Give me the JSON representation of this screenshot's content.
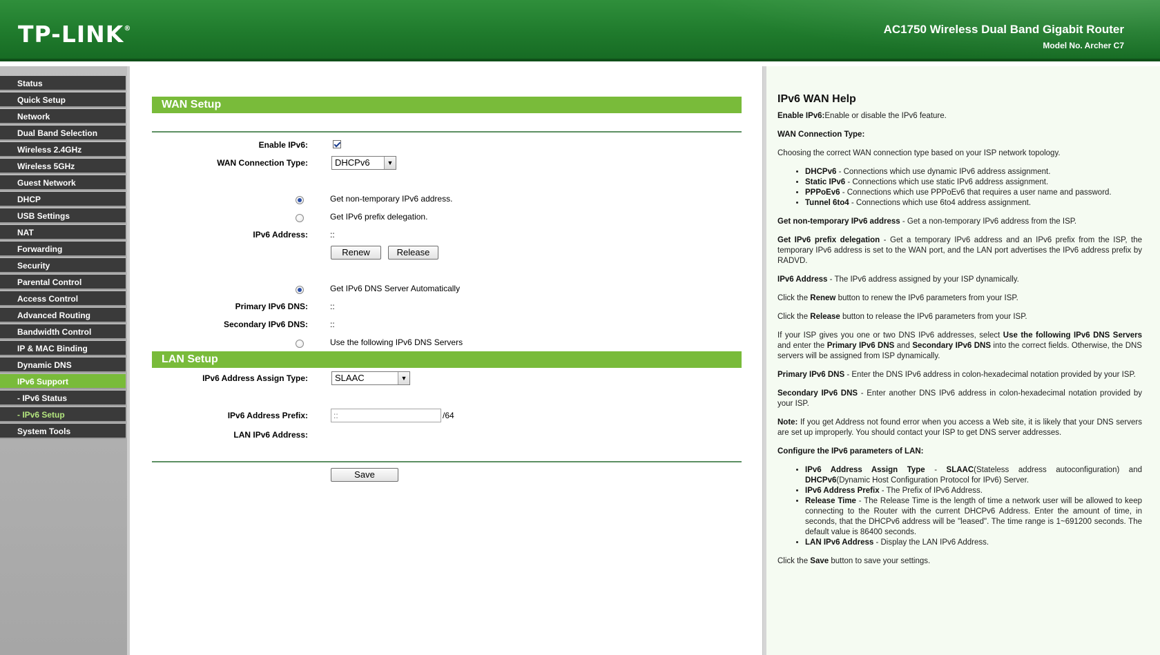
{
  "header": {
    "logo": "TP-LINK",
    "logo_mark": "®",
    "product": "AC1750 Wireless Dual Band Gigabit Router",
    "model": "Model No. Archer C7"
  },
  "colors": {
    "header_green": "#1f7a2c",
    "section_green": "#79bb3a",
    "menu_dark": "#3a3a3a",
    "menu_active": "#79bb3a",
    "submenu_current_text": "#b4e67f",
    "help_bg": "#f5fbf2"
  },
  "sidebar": {
    "items": [
      {
        "label": "Status"
      },
      {
        "label": "Quick Setup"
      },
      {
        "label": "Network"
      },
      {
        "label": "Dual Band Selection"
      },
      {
        "label": "Wireless 2.4GHz"
      },
      {
        "label": "Wireless 5GHz"
      },
      {
        "label": "Guest Network"
      },
      {
        "label": "DHCP"
      },
      {
        "label": "USB Settings"
      },
      {
        "label": "NAT"
      },
      {
        "label": "Forwarding"
      },
      {
        "label": "Security"
      },
      {
        "label": "Parental Control"
      },
      {
        "label": "Access Control"
      },
      {
        "label": "Advanced Routing"
      },
      {
        "label": "Bandwidth Control"
      },
      {
        "label": "IP & MAC Binding"
      },
      {
        "label": "Dynamic DNS"
      },
      {
        "label": "IPv6 Support"
      },
      {
        "label": "- IPv6 Status"
      },
      {
        "label": "- IPv6 Setup"
      },
      {
        "label": "System Tools"
      }
    ]
  },
  "wan": {
    "title": "WAN Setup",
    "enable_label": "Enable IPv6:",
    "enable_checked": true,
    "conn_type_label": "WAN Connection Type:",
    "conn_type_value": "DHCPv6",
    "opt_nontemp": "Get non-temporary IPv6 address.",
    "opt_prefix": "Get IPv6 prefix delegation.",
    "addr_label": "IPv6 Address:",
    "addr_value": "::",
    "renew": "Renew",
    "release": "Release",
    "dns_auto": "Get IPv6 DNS Server Automatically",
    "primary_dns_label": "Primary IPv6 DNS:",
    "primary_dns_value": "::",
    "secondary_dns_label": "Secondary IPv6 DNS:",
    "secondary_dns_value": "::",
    "dns_manual": "Use the following IPv6 DNS Servers"
  },
  "lan": {
    "title": "LAN Setup",
    "assign_label": "IPv6 Address Assign Type:",
    "assign_value": "SLAAC",
    "prefix_label": "IPv6 Address Prefix:",
    "prefix_value": "::",
    "prefix_suffix": "/64",
    "lan_addr_label": "LAN IPv6 Address:",
    "save": "Save"
  },
  "help": {
    "title": "IPv6 WAN Help",
    "enable_b": "Enable IPv6:",
    "enable_t": "Enable or disable the IPv6 feature.",
    "wct_b": "WAN Connection Type:",
    "choose": "Choosing the correct WAN connection type based on your ISP network topology.",
    "dhcp_b": "DHCPv6",
    "dhcp_t": " - Connections which use dynamic IPv6 address assignment.",
    "static_b": "Static IPv6",
    "static_t": " - Connections which use static IPv6 address assignment.",
    "pppoe_b": "PPPoEv6",
    "pppoe_t": " - Connections which use PPPoEv6 that requires a user name and password.",
    "tunnel_b": "Tunnel 6to4",
    "tunnel_t": " - Connections which use 6to4 address assignment.",
    "nontemp_b": "Get non-temporary IPv6 address",
    "nontemp_t": " - Get a non-temporary IPv6 address from the ISP.",
    "prefix_b": "Get IPv6 prefix delegation",
    "prefix_t": " - Get a temporary IPv6 address and an IPv6 prefix from the ISP, the temporary IPv6 address is set to the WAN port, and the LAN port advertises the IPv6 address prefix by RADVD.",
    "addr_b": "IPv6 Address",
    "addr_t": " - The IPv6 address assigned by your ISP dynamically.",
    "renew_pre": "Click the ",
    "renew_b": "Renew",
    "renew_post": " button to renew the IPv6 parameters from your ISP.",
    "release_pre": "Click the ",
    "release_b": "Release",
    "release_post": " button to release the IPv6 parameters from your ISP.",
    "dns1_pre": "If your ISP gives you one or two DNS IPv6 addresses, select ",
    "dns1_b1": "Use the following IPv6 DNS Servers",
    "dns1_mid1": " and enter the ",
    "dns1_b2": "Primary IPv6 DNS",
    "dns1_mid2": " and ",
    "dns1_b3": "Secondary IPv6 DNS",
    "dns1_post": " into the correct fields. Otherwise, the DNS servers will be assigned from ISP dynamically.",
    "pdns_b": "Primary IPv6 DNS",
    "pdns_t": " - Enter the DNS IPv6 address in colon-hexadecimal notation provided by your ISP.",
    "sdns_b": "Secondary IPv6 DNS",
    "sdns_t": " - Enter another DNS IPv6 address in colon-hexadecimal notation provided by your ISP.",
    "note_b": "Note:",
    "note_t": " If you get Address not found error when you access a Web site, it is likely that your DNS servers are set up improperly. You should contact your ISP to get DNS server addresses.",
    "lan_b": "Configure the IPv6 parameters of LAN:",
    "assign_b": "IPv6 Address Assign Type",
    "assign_t1": " - ",
    "assign_b2": "SLAAC",
    "assign_t2": "(Stateless address autoconfiguration) and ",
    "assign_b3": "DHCPv6",
    "assign_t3": "(Dynamic Host Configuration Protocol for IPv6) Server.",
    "pfx_b": "IPv6 Address Prefix",
    "pfx_t": " - The Prefix of IPv6 Address.",
    "rel_b": "Release Time",
    "rel_t": " - The Release Time is the length of time a network user will be allowed to keep connecting to the Router with the current DHCPv6 Address. Enter the amount of time, in seconds, that the DHCPv6 address will be \"leased\". The time range is 1~691200 seconds. The default value is 86400 seconds.",
    "lanaddr_b": "LAN IPv6 Address",
    "lanaddr_t": " - Display the LAN IPv6 Address.",
    "save_pre": "Click the ",
    "save_b": "Save",
    "save_post": " button to save your settings."
  }
}
